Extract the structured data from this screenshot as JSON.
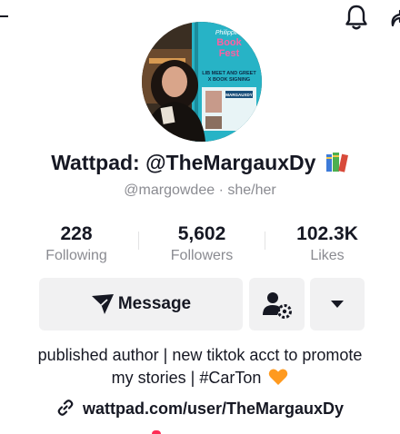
{
  "header": {
    "back_icon": "back-arrow-icon",
    "notification_icon": "bell-icon",
    "share_icon": "share-arrow-icon"
  },
  "profile": {
    "display_name": "Wattpad: @TheMargauxDy",
    "display_name_emoji": "books-emoji",
    "username": "@margowdee · she/her",
    "avatar_poster_lines": [
      "Philippine",
      "Book",
      "Fest",
      "LIB MEET AND GREET",
      "X BOOK SIGNING",
      "MARGAUXDY"
    ]
  },
  "stats": {
    "following": {
      "value": "228",
      "label": "Following"
    },
    "followers": {
      "value": "5,602",
      "label": "Followers"
    },
    "likes": {
      "value": "102.3K",
      "label": "Likes"
    }
  },
  "actions": {
    "message_label": "Message",
    "message_icon": "send-icon",
    "follow_icon": "user-settings-icon",
    "more_icon": "caret-down-icon"
  },
  "bio": {
    "line1": "published author | new tiktok acct to promote",
    "line2": "my stories | #CarTon",
    "emoji": "orange-heart",
    "link_icon": "link-icon",
    "link": "wattpad.com/user/TheMargauxDy"
  },
  "colors": {
    "text": "#161823",
    "secondary": "#8a8b91",
    "button_bg": "#f1f1f2",
    "accent": "#fe2c55",
    "heart": "#ff9a1f"
  }
}
